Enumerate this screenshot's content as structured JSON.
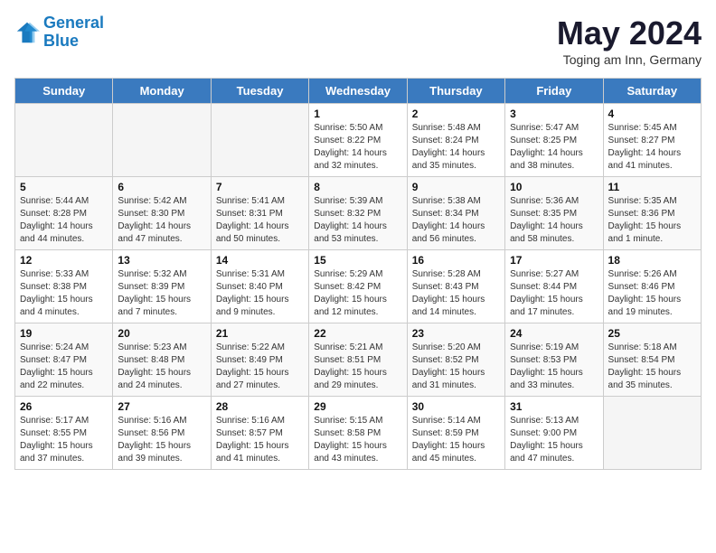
{
  "logo": {
    "line1": "General",
    "line2": "Blue"
  },
  "title": "May 2024",
  "subtitle": "Toging am Inn, Germany",
  "days_of_week": [
    "Sunday",
    "Monday",
    "Tuesday",
    "Wednesday",
    "Thursday",
    "Friday",
    "Saturday"
  ],
  "weeks": [
    [
      {
        "day": "",
        "info": ""
      },
      {
        "day": "",
        "info": ""
      },
      {
        "day": "",
        "info": ""
      },
      {
        "day": "1",
        "info": "Sunrise: 5:50 AM\nSunset: 8:22 PM\nDaylight: 14 hours\nand 32 minutes."
      },
      {
        "day": "2",
        "info": "Sunrise: 5:48 AM\nSunset: 8:24 PM\nDaylight: 14 hours\nand 35 minutes."
      },
      {
        "day": "3",
        "info": "Sunrise: 5:47 AM\nSunset: 8:25 PM\nDaylight: 14 hours\nand 38 minutes."
      },
      {
        "day": "4",
        "info": "Sunrise: 5:45 AM\nSunset: 8:27 PM\nDaylight: 14 hours\nand 41 minutes."
      }
    ],
    [
      {
        "day": "5",
        "info": "Sunrise: 5:44 AM\nSunset: 8:28 PM\nDaylight: 14 hours\nand 44 minutes."
      },
      {
        "day": "6",
        "info": "Sunrise: 5:42 AM\nSunset: 8:30 PM\nDaylight: 14 hours\nand 47 minutes."
      },
      {
        "day": "7",
        "info": "Sunrise: 5:41 AM\nSunset: 8:31 PM\nDaylight: 14 hours\nand 50 minutes."
      },
      {
        "day": "8",
        "info": "Sunrise: 5:39 AM\nSunset: 8:32 PM\nDaylight: 14 hours\nand 53 minutes."
      },
      {
        "day": "9",
        "info": "Sunrise: 5:38 AM\nSunset: 8:34 PM\nDaylight: 14 hours\nand 56 minutes."
      },
      {
        "day": "10",
        "info": "Sunrise: 5:36 AM\nSunset: 8:35 PM\nDaylight: 14 hours\nand 58 minutes."
      },
      {
        "day": "11",
        "info": "Sunrise: 5:35 AM\nSunset: 8:36 PM\nDaylight: 15 hours\nand 1 minute."
      }
    ],
    [
      {
        "day": "12",
        "info": "Sunrise: 5:33 AM\nSunset: 8:38 PM\nDaylight: 15 hours\nand 4 minutes."
      },
      {
        "day": "13",
        "info": "Sunrise: 5:32 AM\nSunset: 8:39 PM\nDaylight: 15 hours\nand 7 minutes."
      },
      {
        "day": "14",
        "info": "Sunrise: 5:31 AM\nSunset: 8:40 PM\nDaylight: 15 hours\nand 9 minutes."
      },
      {
        "day": "15",
        "info": "Sunrise: 5:29 AM\nSunset: 8:42 PM\nDaylight: 15 hours\nand 12 minutes."
      },
      {
        "day": "16",
        "info": "Sunrise: 5:28 AM\nSunset: 8:43 PM\nDaylight: 15 hours\nand 14 minutes."
      },
      {
        "day": "17",
        "info": "Sunrise: 5:27 AM\nSunset: 8:44 PM\nDaylight: 15 hours\nand 17 minutes."
      },
      {
        "day": "18",
        "info": "Sunrise: 5:26 AM\nSunset: 8:46 PM\nDaylight: 15 hours\nand 19 minutes."
      }
    ],
    [
      {
        "day": "19",
        "info": "Sunrise: 5:24 AM\nSunset: 8:47 PM\nDaylight: 15 hours\nand 22 minutes."
      },
      {
        "day": "20",
        "info": "Sunrise: 5:23 AM\nSunset: 8:48 PM\nDaylight: 15 hours\nand 24 minutes."
      },
      {
        "day": "21",
        "info": "Sunrise: 5:22 AM\nSunset: 8:49 PM\nDaylight: 15 hours\nand 27 minutes."
      },
      {
        "day": "22",
        "info": "Sunrise: 5:21 AM\nSunset: 8:51 PM\nDaylight: 15 hours\nand 29 minutes."
      },
      {
        "day": "23",
        "info": "Sunrise: 5:20 AM\nSunset: 8:52 PM\nDaylight: 15 hours\nand 31 minutes."
      },
      {
        "day": "24",
        "info": "Sunrise: 5:19 AM\nSunset: 8:53 PM\nDaylight: 15 hours\nand 33 minutes."
      },
      {
        "day": "25",
        "info": "Sunrise: 5:18 AM\nSunset: 8:54 PM\nDaylight: 15 hours\nand 35 minutes."
      }
    ],
    [
      {
        "day": "26",
        "info": "Sunrise: 5:17 AM\nSunset: 8:55 PM\nDaylight: 15 hours\nand 37 minutes."
      },
      {
        "day": "27",
        "info": "Sunrise: 5:16 AM\nSunset: 8:56 PM\nDaylight: 15 hours\nand 39 minutes."
      },
      {
        "day": "28",
        "info": "Sunrise: 5:16 AM\nSunset: 8:57 PM\nDaylight: 15 hours\nand 41 minutes."
      },
      {
        "day": "29",
        "info": "Sunrise: 5:15 AM\nSunset: 8:58 PM\nDaylight: 15 hours\nand 43 minutes."
      },
      {
        "day": "30",
        "info": "Sunrise: 5:14 AM\nSunset: 8:59 PM\nDaylight: 15 hours\nand 45 minutes."
      },
      {
        "day": "31",
        "info": "Sunrise: 5:13 AM\nSunset: 9:00 PM\nDaylight: 15 hours\nand 47 minutes."
      },
      {
        "day": "",
        "info": ""
      }
    ]
  ]
}
